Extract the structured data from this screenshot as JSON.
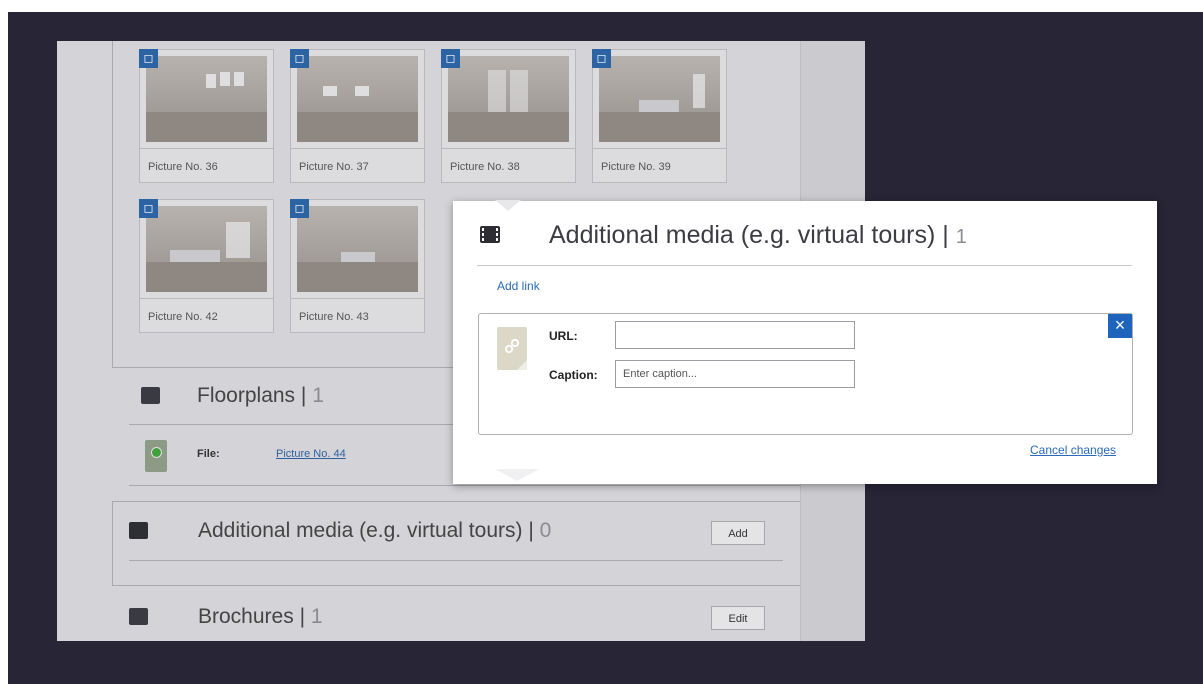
{
  "gallery": {
    "pictures": [
      {
        "label": "Picture No. 36"
      },
      {
        "label": "Picture No. 37"
      },
      {
        "label": "Picture No. 38"
      },
      {
        "label": "Picture No. 39"
      },
      {
        "label": "Picture No. 42"
      },
      {
        "label": "Picture No. 43"
      }
    ],
    "badge_icon": "expand-icon"
  },
  "floorplans": {
    "title": "Floorplans",
    "separator": "|",
    "count": "1",
    "file_label": "File:",
    "file_link": "Picture No. 44"
  },
  "additional_media_bg": {
    "title": "Additional media (e.g. virtual tours)",
    "separator": "|",
    "count": "0",
    "button": "Add"
  },
  "brochures": {
    "title": "Brochures",
    "separator": "|",
    "count": "1",
    "button": "Edit"
  },
  "popup": {
    "title": "Additional media (e.g. virtual tours)",
    "separator": "|",
    "count": "1",
    "add_link": "Add link",
    "url_label": "URL:",
    "url_value": "",
    "caption_label": "Caption:",
    "caption_placeholder": "Enter caption...",
    "close_glyph": "×",
    "cancel": "Cancel changes"
  },
  "colors": {
    "backdrop": "#272536",
    "accent_blue": "#1e64bd",
    "link_blue": "#2a6ab8"
  }
}
